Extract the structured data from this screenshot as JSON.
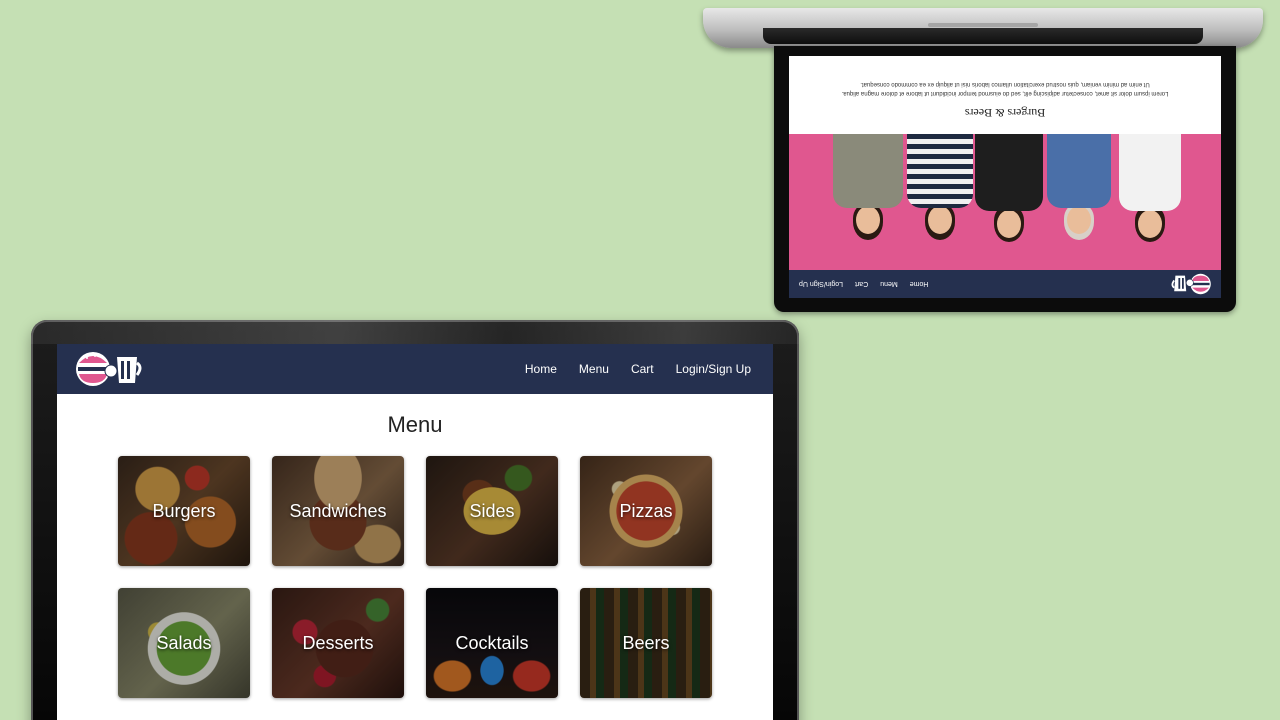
{
  "main_site": {
    "nav": {
      "logo_label": "B&B logo",
      "links": [
        "Home",
        "Menu",
        "Cart",
        "Login/Sign Up"
      ]
    },
    "page_title": "Menu",
    "categories": [
      {
        "label": "Burgers"
      },
      {
        "label": "Sandwiches"
      },
      {
        "label": "Sides"
      },
      {
        "label": "Pizzas"
      },
      {
        "label": "Salads"
      },
      {
        "label": "Desserts"
      },
      {
        "label": "Cocktails"
      },
      {
        "label": "Beers"
      }
    ]
  },
  "mirrored_site": {
    "nav": {
      "links": [
        "Home",
        "Menu",
        "Cart",
        "Login/Sign Up"
      ]
    },
    "title": "Burgers & Beers",
    "intro_line1": "Lorem ipsum dolor sit amet, consectetur adipiscing elit, sed do eiusmod tempor incididunt ut labore et dolore magna aliqua.",
    "intro_line2": "Ut enim ad minim veniam, quis nostrud exercitation ullamco laboris nisi ut aliquip ex ea commodo consequat."
  },
  "colors": {
    "page_background": "#c5e0b4",
    "nav_background": "#25304f",
    "hero_background": "#e0578f",
    "text": "#222222"
  },
  "icons": [
    "burger-icon",
    "beer-mug-icon"
  ]
}
